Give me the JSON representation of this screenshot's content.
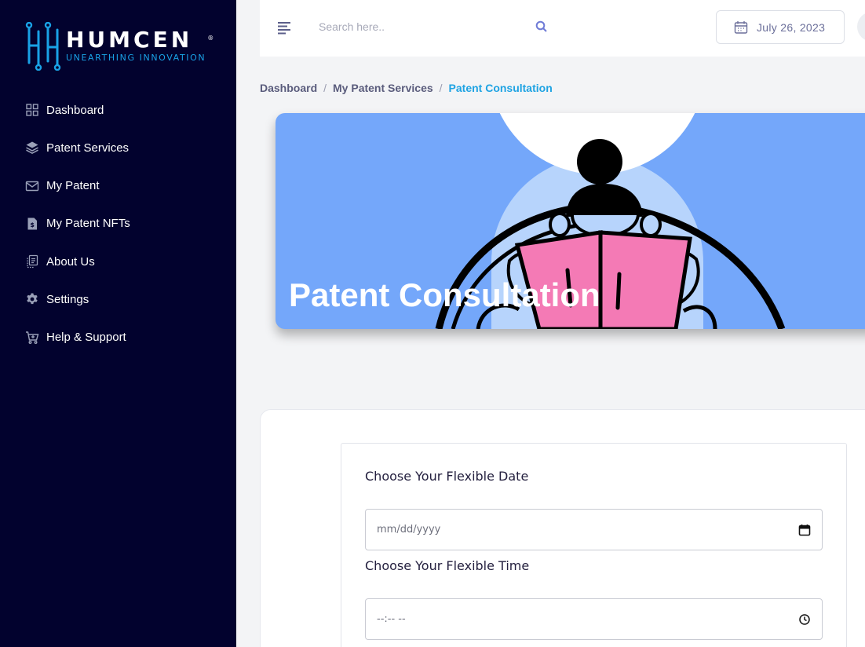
{
  "brand": {
    "name": "HUMCEN",
    "registered": "®",
    "tagline": "UNEARTHING INNOVATION",
    "accent": "#19a2e6"
  },
  "sidebar": {
    "background": "#02022e",
    "items": [
      {
        "label": "Dashboard",
        "icon": "grid-icon"
      },
      {
        "label": "Patent Services",
        "icon": "layers-icon"
      },
      {
        "label": "My Patent",
        "icon": "mail-icon"
      },
      {
        "label": "My Patent NFTs",
        "icon": "dollar-file-icon"
      },
      {
        "label": "About Us",
        "icon": "copy-icon"
      },
      {
        "label": "Settings",
        "icon": "gear-icon"
      },
      {
        "label": "Help & Support",
        "icon": "cart-icon"
      }
    ]
  },
  "header": {
    "search_placeholder": "Search here..",
    "date": "July 26, 2023"
  },
  "breadcrumb": {
    "items": [
      "Dashboard",
      "My Patent Services"
    ],
    "current": "Patent Consultation"
  },
  "banner": {
    "title": "Patent Consultation",
    "background": "#74a7fa"
  },
  "form": {
    "date_label": "Choose Your Flexible Date",
    "date_placeholder": "mm/dd/yyyy",
    "time_label": "Choose Your Flexible Time",
    "time_placeholder": "--:-- --"
  }
}
